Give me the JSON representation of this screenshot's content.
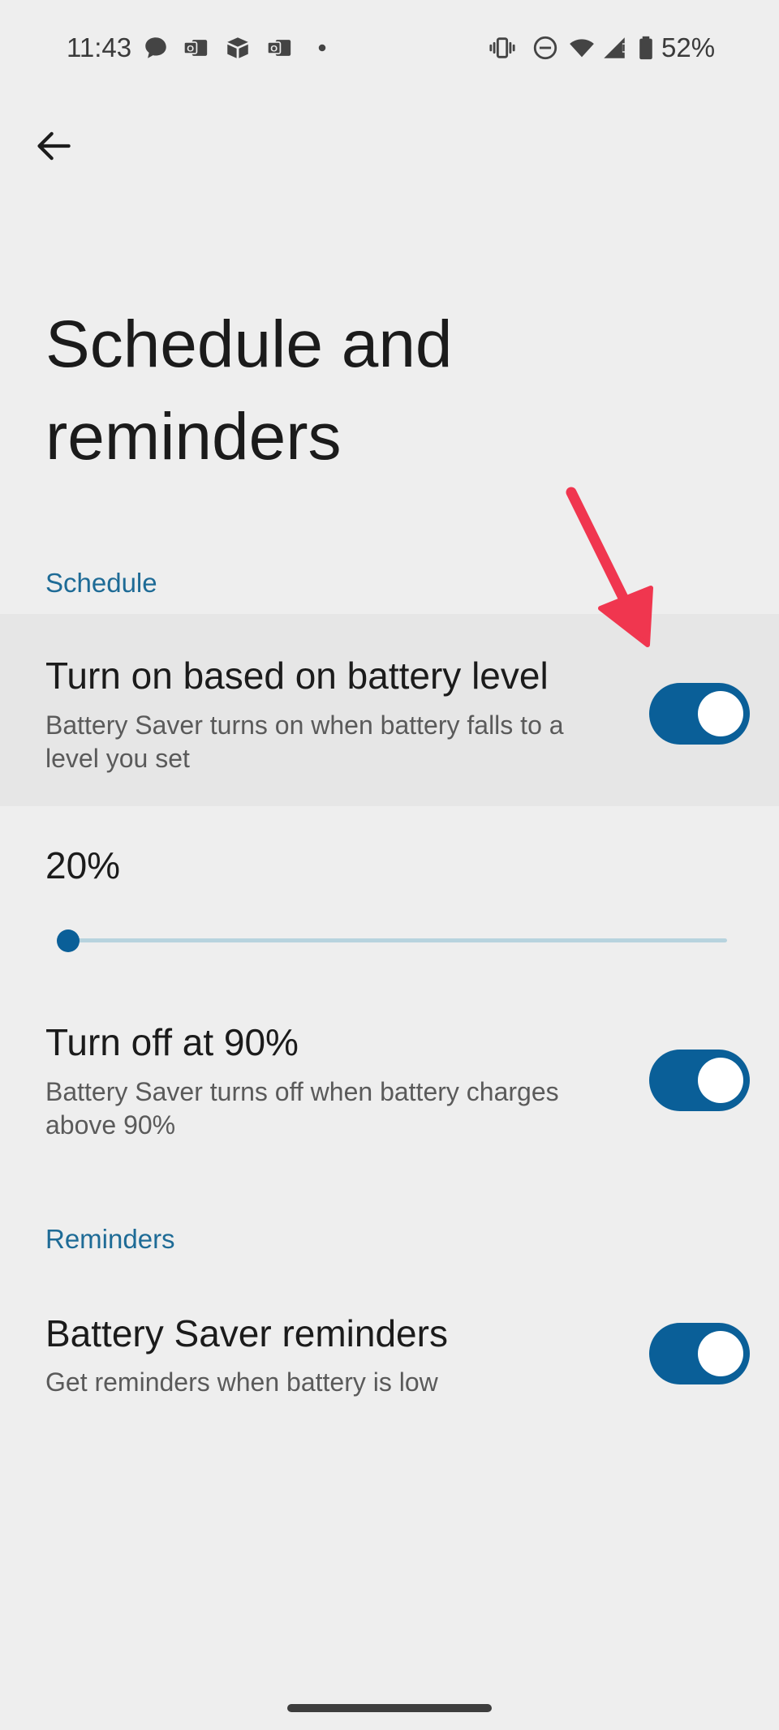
{
  "status_bar": {
    "time": "11:43",
    "battery_percent": "52%",
    "icons": [
      "chat-bubble-icon",
      "outlook-icon",
      "package-icon",
      "outlook-icon",
      "dot-icon",
      "vibrate-icon",
      "do-not-disturb-icon",
      "wifi-icon",
      "signal-icon",
      "battery-icon"
    ]
  },
  "page": {
    "title": "Schedule and reminders"
  },
  "schedule": {
    "header": "Schedule",
    "battery_level_setting": {
      "title": "Turn on based on battery level",
      "summary": "Battery Saver turns on when battery falls to a level you set",
      "enabled": true
    },
    "level_slider": {
      "value_label": "20%",
      "fraction": 0.0
    },
    "turn_off_setting": {
      "title": "Turn off at 90%",
      "summary": "Battery Saver turns off when battery charges above 90%",
      "enabled": true
    }
  },
  "reminders": {
    "header": "Reminders",
    "reminders_setting": {
      "title": "Battery Saver reminders",
      "summary": "Get reminders when battery is low",
      "enabled": true
    }
  },
  "colors": {
    "background": "#eeeeee",
    "accent": "#0a5f98",
    "section_header": "#1e6b96",
    "annotation": "#f0364f"
  }
}
